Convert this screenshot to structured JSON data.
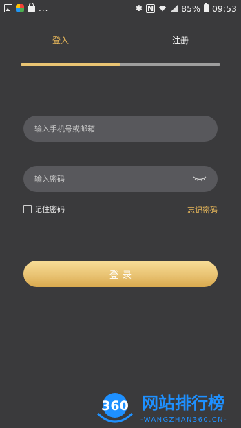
{
  "status_bar": {
    "dots": "...",
    "battery": "85%",
    "time": "09:53"
  },
  "tabs": {
    "login": "登入",
    "register": "注册",
    "active_progress": 0.5
  },
  "form": {
    "phone_placeholder": "输入手机号或邮箱",
    "password_placeholder": "输入密码",
    "remember_label": "记住密码",
    "forgot_label": "忘记密码",
    "login_button": "登录"
  },
  "watermark": {
    "badge": "360",
    "name": "网站排行榜",
    "url": "-WANGZHAN360.CN-"
  },
  "colors": {
    "background": "#3a3a3c",
    "accent": "#e8b85a",
    "field": "#58585c",
    "button_top": "#f8dd97",
    "button_bottom": "#d9a94e",
    "watermark_blue": "#1e90ff"
  }
}
